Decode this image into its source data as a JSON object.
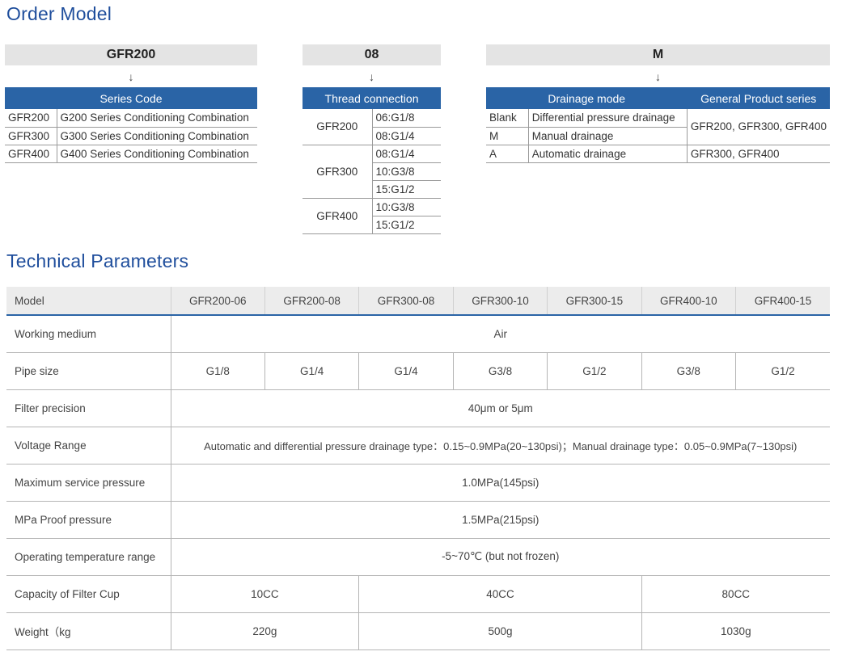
{
  "order": {
    "title": "Order Model",
    "codes": [
      "GFR200",
      "08",
      "M"
    ],
    "arrow": "↓",
    "series": {
      "header": "Series Code",
      "rows": [
        [
          "GFR200",
          "G200 Series Conditioning Combination"
        ],
        [
          "GFR300",
          "G300 Series Conditioning Combination"
        ],
        [
          "GFR400",
          "G400 Series Conditioning Combination"
        ]
      ]
    },
    "thread": {
      "header": "Thread connection",
      "groups": [
        {
          "model": "GFR200",
          "options": [
            "06:G1/8",
            "08:G1/4"
          ]
        },
        {
          "model": "GFR300",
          "options": [
            "08:G1/4",
            "10:G3/8",
            "15:G1/2"
          ]
        },
        {
          "model": "GFR400",
          "options": [
            "10:G3/8",
            "15:G1/2"
          ]
        }
      ]
    },
    "drain": {
      "headers": [
        "Drainage mode",
        "General Product series"
      ],
      "rows": [
        {
          "code": "Blank",
          "mode": "Differential pressure drainage"
        },
        {
          "code": "M",
          "mode": "Manual drainage"
        },
        {
          "code": "A",
          "mode": "Automatic drainage"
        }
      ],
      "series_a": "GFR200, GFR300, GFR400",
      "series_b": "GFR300, GFR400"
    }
  },
  "tech": {
    "title": "Technical Parameters",
    "model_label": "Model",
    "models": [
      "GFR200-06",
      "GFR200-08",
      "GFR300-08",
      "GFR300-10",
      "GFR300-15",
      "GFR400-10",
      "GFR400-15"
    ],
    "working_medium": {
      "label": "Working medium",
      "value": "Air"
    },
    "pipe_size": {
      "label": "Pipe size",
      "values": [
        "G1/8",
        "G1/4",
        "G1/4",
        "G3/8",
        "G1/2",
        "G3/8",
        "G1/2"
      ]
    },
    "filter_precision": {
      "label": "Filter precision",
      "value": "40μm or 5μm"
    },
    "voltage_range": {
      "label": "Voltage Range",
      "value": "Automatic and differential pressure drainage type：0.15~0.9MPa(20~130psi)；Manual drainage type：0.05~0.9MPa(7~130psi)"
    },
    "max_pressure": {
      "label": "Maximum service pressure",
      "value": "1.0MPa(145psi)"
    },
    "proof_pressure": {
      "label": "MPa Proof pressure",
      "value": "1.5MPa(215psi)"
    },
    "temp_range": {
      "label": "Operating temperature range",
      "value": "-5~70℃ (but not frozen)"
    },
    "capacity": {
      "label": "Capacity of Filter Cup",
      "values": [
        "10CC",
        "40CC",
        "80CC"
      ]
    },
    "weight": {
      "label": "Weight（kg",
      "values": [
        "220g",
        "500g",
        "1030g"
      ]
    }
  }
}
